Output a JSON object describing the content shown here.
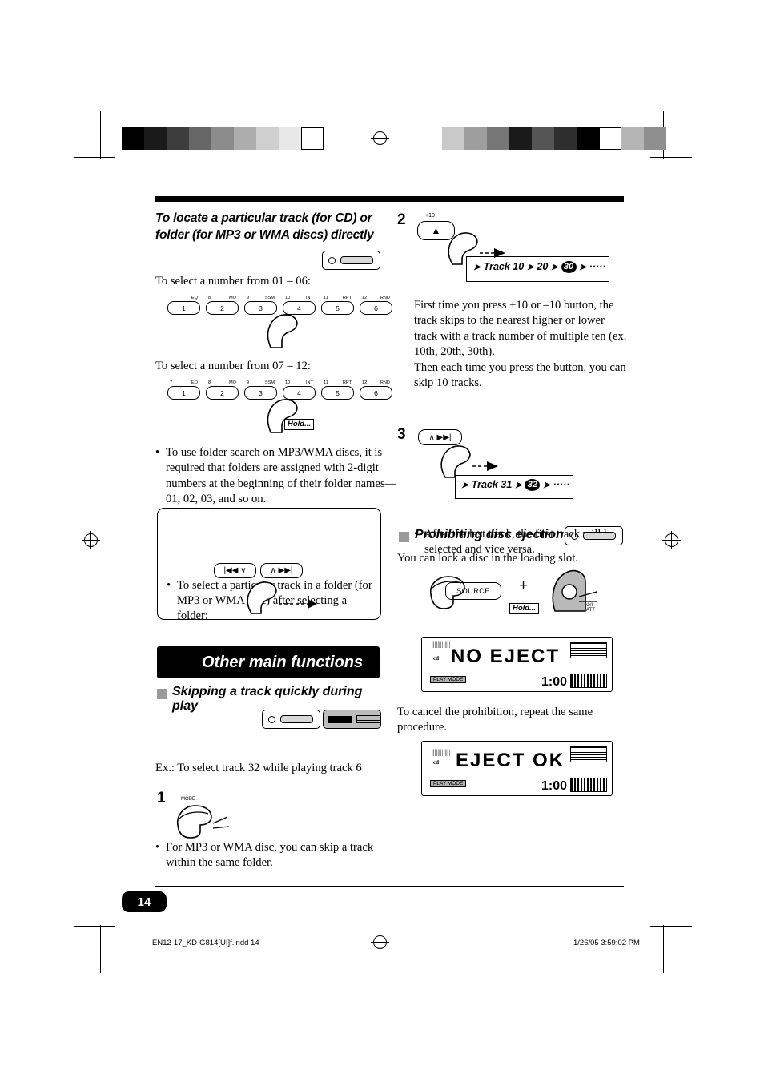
{
  "page": {
    "number": "14",
    "footer_left": "EN12-17_KD-G814[UI]f.indd   14",
    "footer_right": "1/26/05   3:59:02 PM"
  },
  "left_column": {
    "heading": "To locate a particular track (for CD) or folder (for MP3 or WMA discs) directly",
    "instruction_1": "To select a number from 01 – 06:",
    "instruction_2": "To select a number from 07 – 12:",
    "hold_label": "Hold...",
    "keys_row1": [
      {
        "top_left": "7",
        "top_right": "EQ",
        "label": "1"
      },
      {
        "top_left": "8",
        "top_right": "MO",
        "label": "2"
      },
      {
        "top_left": "9",
        "top_right": "SSM",
        "label": "3"
      },
      {
        "top_left": "10",
        "top_right": "INT",
        "label": "4"
      },
      {
        "top_left": "11",
        "top_right": "RPT",
        "label": "5"
      },
      {
        "top_left": "12",
        "top_right": "RND",
        "label": "6"
      }
    ],
    "keys_row2": [
      {
        "top_left": "7",
        "top_right": "EQ",
        "label": "1"
      },
      {
        "top_left": "8",
        "top_right": "MO",
        "label": "2"
      },
      {
        "top_left": "9",
        "top_right": "SSM",
        "label": "3"
      },
      {
        "top_left": "10",
        "top_right": "INT",
        "label": "4"
      },
      {
        "top_left": "11",
        "top_right": "RPT",
        "label": "5"
      },
      {
        "top_left": "12",
        "top_right": "RND",
        "label": "6"
      }
    ],
    "bullet_folder_search": "To use folder search on MP3/WMA discs, it is required that folders are assigned with 2-digit numbers at the beginning of their folder names—01, 02, 03, and so on.",
    "box_bullet": "To select a particular track in a folder (for MP3 or WMA disc) after selecting a folder:",
    "box_button_left": "|◀◀  ∨",
    "box_button_right": "∧  ▶▶|",
    "other_main_functions": "Other main functions",
    "skipping_heading": "Skipping a track quickly during play",
    "skipping_bullet": "For MP3 or WMA disc, you can skip a track within the same folder.",
    "skipping_example": "Ex.: To select track 32 while playing track 6",
    "step1": "1",
    "step1_button_label": "MODE"
  },
  "right_column": {
    "step2": "2",
    "step2_button_label": "+10",
    "step2_flow": {
      "prefix": "Track 10",
      "mid": "20",
      "oval": "30",
      "suffix": "·····"
    },
    "paragraph_1": "First time you press +10 or –10 button, the track skips to the nearest higher or lower track with a track number of multiple ten (ex. 10th, 20th, 30th).",
    "paragraph_2": "Then each time you press the button, you can skip 10 tracks.",
    "bullet_1": "After the last track, the first track will be selected and vice versa.",
    "step3": "3",
    "step3_button_label": "∧  ▶▶|",
    "step3_flow": {
      "prefix": "Track 31",
      "oval": "32",
      "suffix": "·····"
    },
    "prohibit_heading": "Prohibiting disc ejection",
    "prohibit_text": "You can lock a disc in the loading slot.",
    "source_button": "SOURCE",
    "hold_label": "Hold...",
    "plus_sign": "+",
    "eject_knob_label": "⏻/I\nATT",
    "display_1": "NO EJECT",
    "display_1_time": "1:00",
    "display_1_mode": "PLAY MODE",
    "display_1_cd": "cd",
    "cancel_text": "To cancel the prohibition, repeat the same procedure.",
    "display_2": "EJECT OK",
    "display_2_time": "1:00",
    "display_2_mode": "PLAY MODE",
    "display_2_cd": "cd"
  },
  "colors": {
    "black": "#000000",
    "grey_bullet": "#9a9a9a",
    "bar_fill": "#d8d8d8"
  }
}
